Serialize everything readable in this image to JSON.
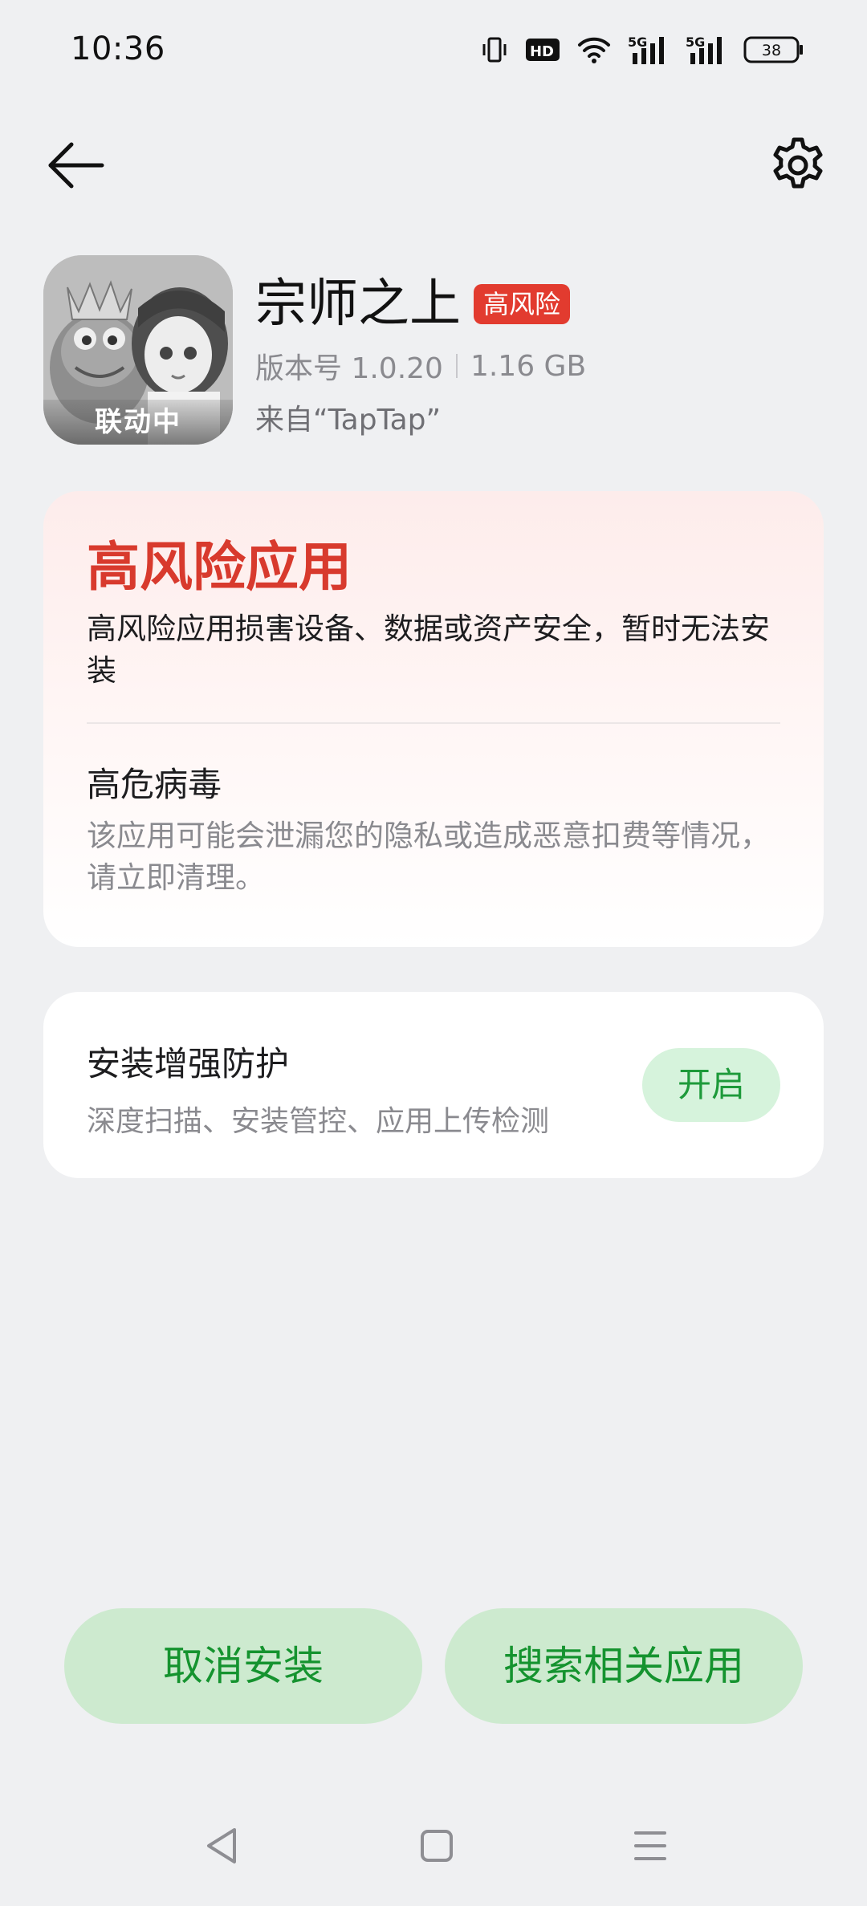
{
  "status_bar": {
    "time": "10:36",
    "battery": "38",
    "icons": [
      "vibrate-icon",
      "hd-icon",
      "wifi-icon",
      "5g-signal-icon",
      "5g-signal-icon",
      "battery-icon"
    ],
    "network_1": "5G",
    "network_2": "5G",
    "hd_label": "HD"
  },
  "top_nav": {
    "back_icon": "back-arrow-icon",
    "settings_icon": "gear-icon"
  },
  "app": {
    "name": "宗师之上",
    "risk_badge": "高风险",
    "version": "版本号 1.0.20",
    "size": "1.16 GB",
    "source": "来自“TapTap”",
    "icon_banner": "联动中"
  },
  "risk_card": {
    "title": "高风险应用",
    "description": "高风险应用损害设备、数据或资产安全，暂时无法安装",
    "virus_title": "高危病毒",
    "virus_description": "该应用可能会泄漏您的隐私或造成恶意扣费等情况，请立即清理。"
  },
  "protection_card": {
    "title": "安装增强防护",
    "description": "深度扫描、安装管控、应用上传检测",
    "button": "开启"
  },
  "actions": {
    "cancel": "取消安装",
    "search": "搜索相关应用"
  },
  "nav_bar": {
    "items": [
      "nav-back-icon",
      "nav-home-icon",
      "nav-recent-icon"
    ]
  },
  "colors": {
    "background": "#eff0f2",
    "risk_red": "#d83a2d",
    "badge_red": "#e23b2f",
    "green_text": "#15932f",
    "green_button": "#cdeacf"
  }
}
